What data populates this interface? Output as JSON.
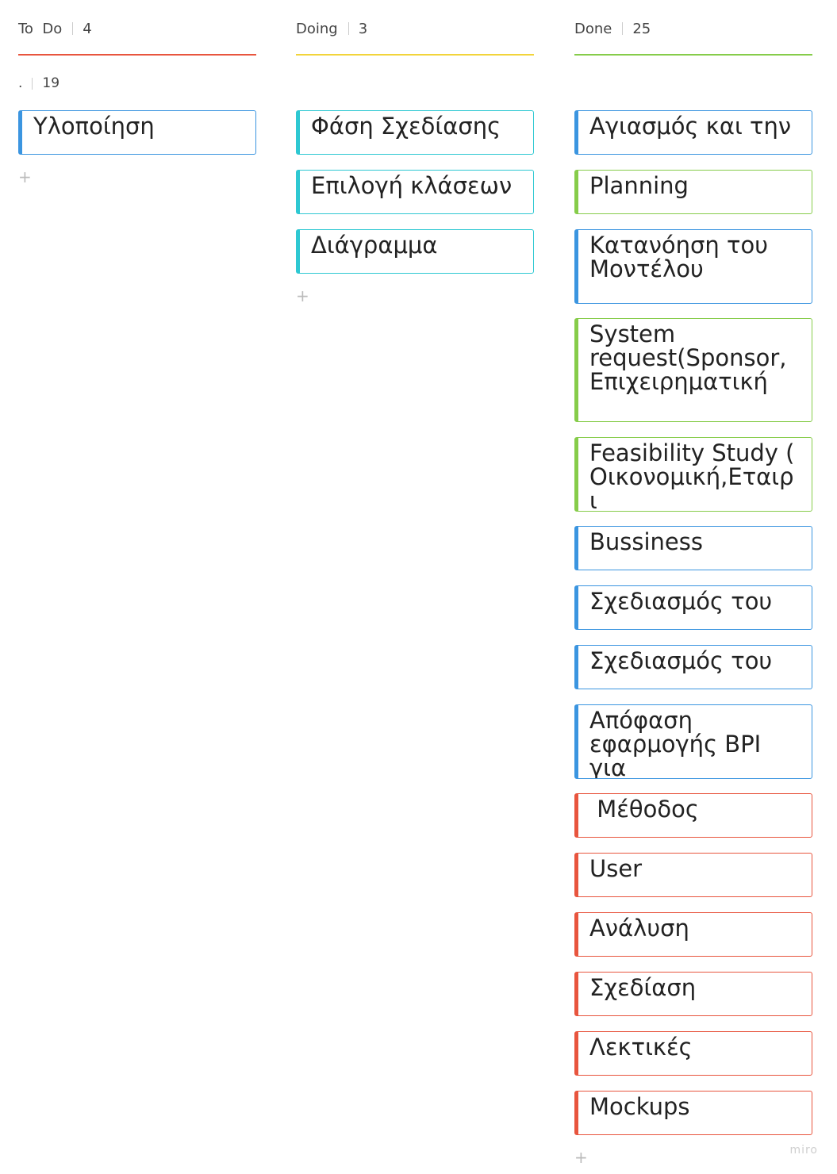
{
  "columns": [
    {
      "title": "To  Do",
      "count": "4",
      "color": "#e8553e",
      "swimlane": {
        "name": ".",
        "count": "19"
      },
      "cards": [
        {
          "text": "Υλοποίηση",
          "color": "#3b95e0"
        }
      ]
    },
    {
      "title": "Doing",
      "count": "3",
      "color": "#f2d43a",
      "cards": [
        {
          "text": "Φάση Σχεδίασης",
          "color": "#2ec8d2"
        },
        {
          "text": "Επιλογή κλάσεων",
          "color": "#2ec8d2"
        },
        {
          "text": "Διάγραμμα",
          "color": "#2ec8d2"
        }
      ]
    },
    {
      "title": "Done",
      "count": "25",
      "color": "#86cc4a",
      "cards": [
        {
          "text": "Αγιασμός και την",
          "color": "#3b95e0"
        },
        {
          "text": "Planning",
          "color": "#86cc4a"
        },
        {
          "text": "Κατανόηση του Μοντέλου",
          "color": "#3b95e0"
        },
        {
          "text": "System request(Sponsor,Επιχειρηματική",
          "color": "#86cc4a"
        },
        {
          "text": "Feasibility Study ( Οικονομική,Εταιρι",
          "color": "#86cc4a"
        },
        {
          "text": "Bussiness",
          "color": "#3b95e0"
        },
        {
          "text": "Σχεδιασμός του",
          "color": "#3b95e0"
        },
        {
          "text": "Σχεδιασμός του",
          "color": "#3b95e0"
        },
        {
          "text": "Απόφαση εφαρμογής BPI για",
          "color": "#3b95e0"
        },
        {
          "text": " Μέθοδος",
          "color": "#e8553e"
        },
        {
          "text": "User",
          "color": "#e8553e"
        },
        {
          "text": "Ανάλυση",
          "color": "#e8553e"
        },
        {
          "text": "Σχεδίαση",
          "color": "#e8553e"
        },
        {
          "text": "Λεκτικές",
          "color": "#e8553e"
        },
        {
          "text": "Mockups",
          "color": "#e8553e"
        }
      ]
    }
  ],
  "add_icon": "plus-icon",
  "watermark": "miro"
}
